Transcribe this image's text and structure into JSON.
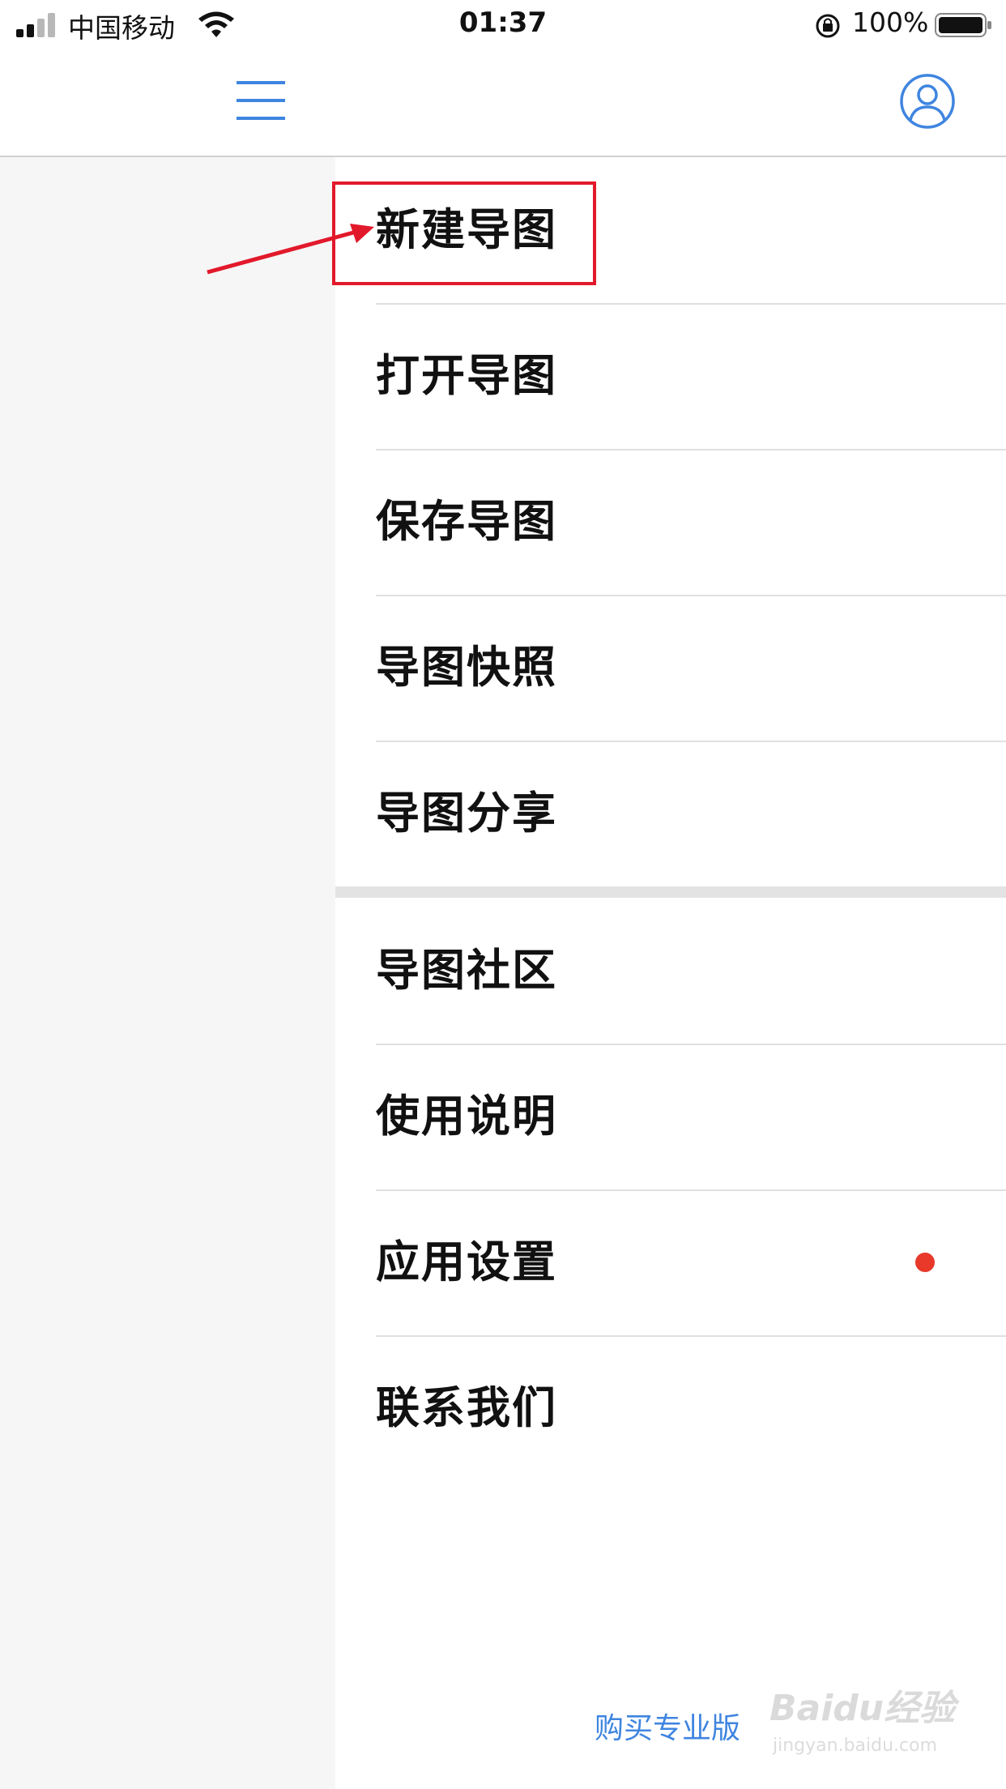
{
  "status_bar": {
    "carrier": "中国移动",
    "time": "01:37",
    "battery": "100%"
  },
  "nav": {
    "menu_icon": "hamburger-menu-icon",
    "user_icon": "user-profile-icon"
  },
  "menu": {
    "group1": [
      {
        "label": "新建导图"
      },
      {
        "label": "打开导图"
      },
      {
        "label": "保存导图"
      },
      {
        "label": "导图快照"
      },
      {
        "label": "导图分享"
      }
    ],
    "group2": [
      {
        "label": "导图社区"
      },
      {
        "label": "使用说明"
      },
      {
        "label": "应用设置",
        "badge": "red-dot"
      },
      {
        "label": "联系我们"
      }
    ]
  },
  "buy_pro": "购买专业版",
  "watermark": {
    "brand": "Baidu经验",
    "url": "jingyan.baidu.com"
  },
  "colors": {
    "accent": "#3f85e0",
    "annotation": "#e2192b",
    "badge": "#e8392b"
  }
}
